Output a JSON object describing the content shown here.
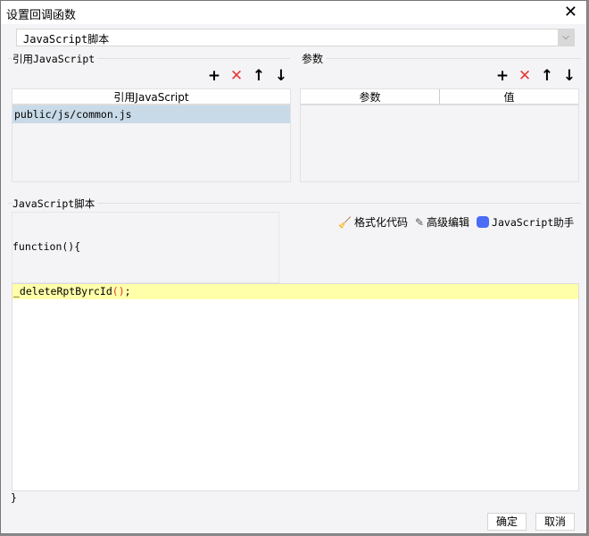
{
  "dialog": {
    "title": "设置回调函数",
    "close_icon": "close-icon"
  },
  "type_select": {
    "value": "JavaScript脚本"
  },
  "ref_js": {
    "group_label": "引用JavaScript",
    "column": "引用JavaScript",
    "rows": [
      "public/js/common.js"
    ]
  },
  "params": {
    "group_label": "参数",
    "columns": [
      "参数",
      "值"
    ],
    "rows": []
  },
  "script": {
    "group_label": "JavaScript脚本",
    "header": "function(){",
    "body_lines": [
      "_deleteRptByrcId();"
    ],
    "footer": "}",
    "tools": {
      "format": "格式化代码",
      "advanced": "高级编辑",
      "assistant": "JavaScript助手"
    }
  },
  "footer": {
    "ok": "确定",
    "cancel": "取消"
  }
}
